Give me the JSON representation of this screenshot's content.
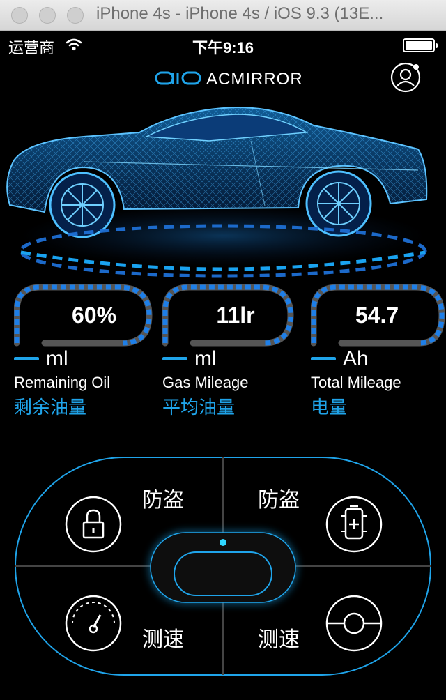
{
  "window": {
    "title": "iPhone 4s - iPhone 4s / iOS 9.3 (13E..."
  },
  "status_bar": {
    "carrier": "运营商",
    "time": "下午9:16"
  },
  "brand": {
    "logo_text": "aio",
    "name": "ACMIRROR"
  },
  "gauges": [
    {
      "value": "60%",
      "unit": "ml",
      "label_en": "Remaining Oil",
      "label_cn": "剩余油量"
    },
    {
      "value": "11lr",
      "unit": "ml",
      "label_en": "Gas Mileage",
      "label_cn": "平均油量"
    },
    {
      "value": "54.7",
      "unit": "Ah",
      "label_en": "Total Mileage",
      "label_cn": "电量"
    }
  ],
  "controls": {
    "top_left_label": "防盗",
    "top_right_label": "防盗",
    "bottom_left_label": "测速",
    "bottom_right_label": "测速",
    "icons": {
      "top_left": "lock-icon",
      "top_right": "battery-charge-icon",
      "bottom_left": "speedometer-icon",
      "bottom_right": "steering-wheel-icon"
    }
  },
  "colors": {
    "accent": "#1fa4ea",
    "background": "#000000",
    "gauge_track": "#555555"
  }
}
